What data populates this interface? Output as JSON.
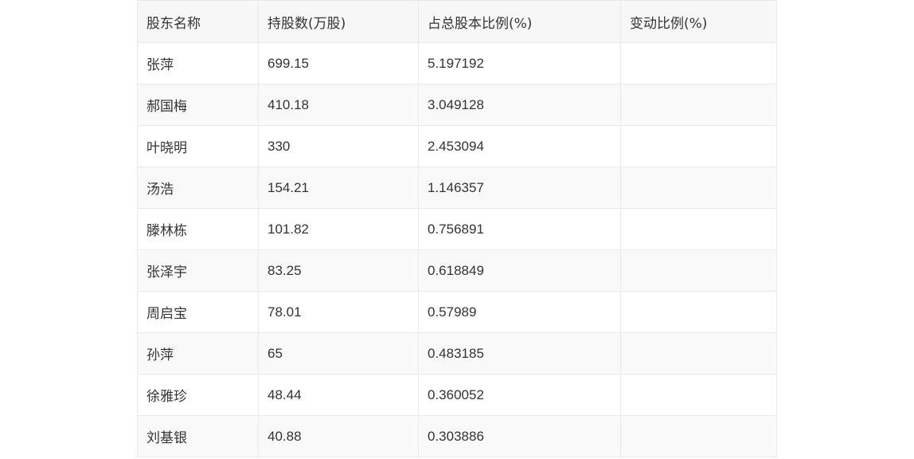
{
  "table": {
    "headers": [
      "股东名称",
      "持股数(万股)",
      "占总股本比例(%)",
      "变动比例(%)"
    ],
    "rows": [
      [
        "张萍",
        "699.15",
        "5.197192",
        ""
      ],
      [
        "郝国梅",
        "410.18",
        "3.049128",
        ""
      ],
      [
        "叶晓明",
        "330",
        "2.453094",
        ""
      ],
      [
        "汤浩",
        "154.21",
        "1.146357",
        ""
      ],
      [
        "滕林栋",
        "101.82",
        "0.756891",
        ""
      ],
      [
        "张泽宇",
        "83.25",
        "0.618849",
        ""
      ],
      [
        "周启宝",
        "78.01",
        "0.57989",
        ""
      ],
      [
        "孙萍",
        "65",
        "0.483185",
        ""
      ],
      [
        "徐雅珍",
        "48.44",
        "0.360052",
        ""
      ],
      [
        "刘基银",
        "40.88",
        "0.303886",
        ""
      ]
    ]
  }
}
